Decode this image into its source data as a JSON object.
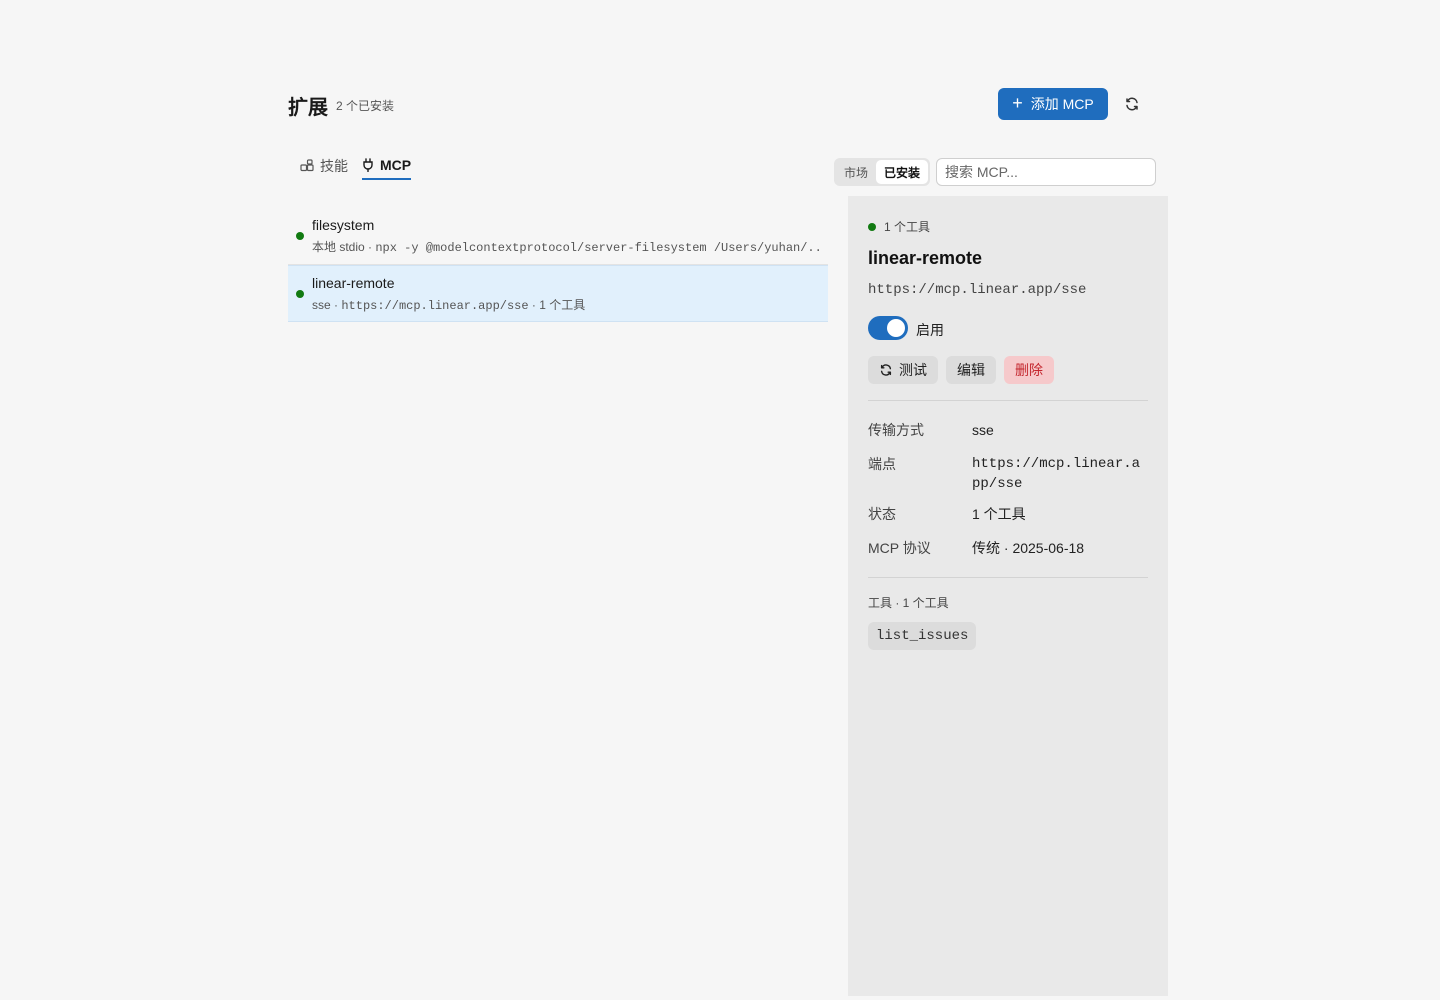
{
  "header": {
    "title": "扩展",
    "subtitle": "2 个已安装",
    "add_button_label": "添加 MCP",
    "add_icon": "plus-icon",
    "refresh_icon": "refresh-icon"
  },
  "tabs": [
    {
      "label": "技能",
      "icon": "puzzle-icon",
      "active": false
    },
    {
      "label": "MCP",
      "icon": "plug-icon",
      "active": true
    }
  ],
  "filter": {
    "segments": [
      {
        "label": "市场",
        "active": false
      },
      {
        "label": "已安装",
        "active": true
      }
    ],
    "search_placeholder": "搜索 MCP..."
  },
  "servers": [
    {
      "name": "filesystem",
      "status_color": "#117a11",
      "meta_prefix": "本地 stdio · ",
      "meta_command": "npx -y @modelcontextprotocol/server-filesystem /Users/yuhan/...",
      "meta_suffix": "",
      "selected": false
    },
    {
      "name": "linear-remote",
      "status_color": "#117a11",
      "meta_prefix": "sse · ",
      "meta_command": "https://mcp.linear.app/sse",
      "meta_suffix": " · 1 个工具",
      "selected": true
    }
  ],
  "detail": {
    "status_text": "1 个工具",
    "name": "linear-remote",
    "url": "https://mcp.linear.app/sse",
    "enabled": true,
    "enabled_label": "启用",
    "actions": {
      "test": "测试",
      "edit": "编辑",
      "delete": "删除"
    },
    "info": [
      {
        "key": "传输方式",
        "value": "sse"
      },
      {
        "key": "端点",
        "value": "https://mcp.linear.app/sse"
      },
      {
        "key": "状态",
        "value": "1 个工具"
      },
      {
        "key": "MCP 协议",
        "value": "传统 · 2025-06-18"
      }
    ],
    "tools_title": "工具 · 1 个工具",
    "tools": [
      "list_issues"
    ]
  },
  "colors": {
    "accent": "#1f6dbe",
    "status_ok": "#117a11",
    "danger": "#c4262e",
    "selected_row": "#e1f0fc"
  }
}
